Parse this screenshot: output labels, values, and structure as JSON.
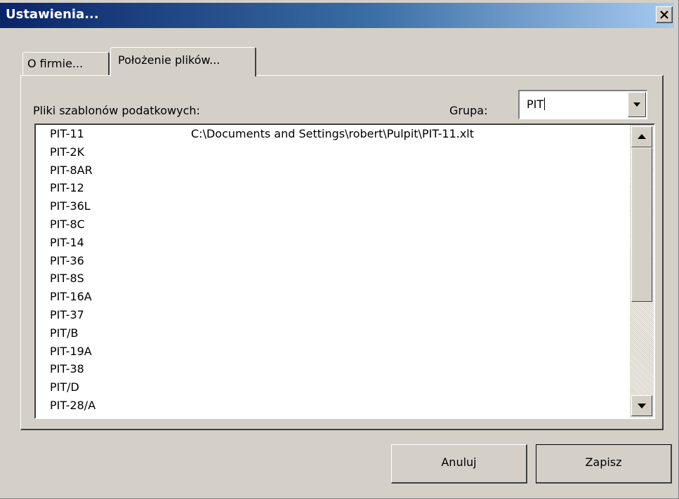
{
  "window": {
    "title": "Ustawienia...",
    "close_label": "×"
  },
  "tabs": [
    {
      "label": "O firmie...",
      "selected": false
    },
    {
      "label": "Położenie plików...",
      "selected": true
    }
  ],
  "panel": {
    "templates_label": "Pliki szablonów podatkowych:",
    "group_label": "Grupa:",
    "group_value": "PIT",
    "items": [
      {
        "name": "PIT-11",
        "path": "C:\\Documents and Settings\\robert\\Pulpit\\PIT-11.xlt"
      },
      {
        "name": "PIT-2K",
        "path": ""
      },
      {
        "name": "PIT-8AR",
        "path": ""
      },
      {
        "name": "PIT-12",
        "path": ""
      },
      {
        "name": "PIT-36L",
        "path": ""
      },
      {
        "name": "PIT-8C",
        "path": ""
      },
      {
        "name": "PIT-14",
        "path": ""
      },
      {
        "name": "PIT-36",
        "path": ""
      },
      {
        "name": "PIT-8S",
        "path": ""
      },
      {
        "name": "PIT-16A",
        "path": ""
      },
      {
        "name": "PIT-37",
        "path": ""
      },
      {
        "name": "PIT/B",
        "path": ""
      },
      {
        "name": "PIT-19A",
        "path": ""
      },
      {
        "name": "PIT-38",
        "path": ""
      },
      {
        "name": "PIT/D",
        "path": ""
      },
      {
        "name": "PIT-28/A",
        "path": ""
      }
    ]
  },
  "buttons": {
    "cancel": "Anuluj",
    "save": "Zapisz"
  },
  "icons": {
    "close": "close-icon",
    "dropdown": "chevron-down-icon",
    "scroll_up": "scroll-up-arrow-icon",
    "scroll_down": "scroll-down-arrow-icon"
  },
  "colors": {
    "title_gradient_start": "#0a246a",
    "title_gradient_end": "#a6caf0",
    "dialog_face": "#d4d0c8"
  }
}
